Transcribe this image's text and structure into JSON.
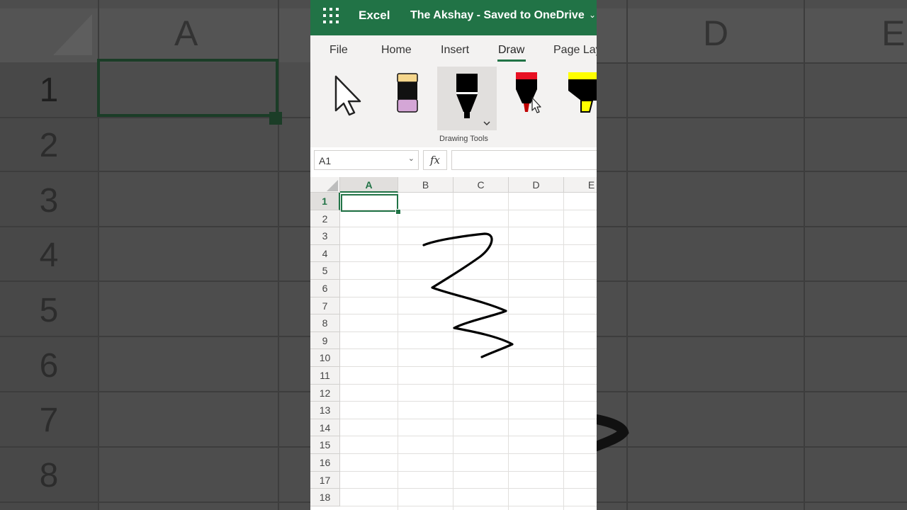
{
  "app": {
    "name": "Excel",
    "document_title": "The Akshay  -  Saved to OneDrive"
  },
  "tabs": [
    {
      "label": "File",
      "active": false
    },
    {
      "label": "Home",
      "active": false
    },
    {
      "label": "Insert",
      "active": false
    },
    {
      "label": "Draw",
      "active": true
    },
    {
      "label": "Page Layout",
      "active": false
    }
  ],
  "ribbon": {
    "group_label": "Drawing Tools",
    "tools": [
      {
        "name": "select-tool",
        "icon": "cursor-arrow"
      },
      {
        "name": "eraser-tool",
        "icon": "eraser"
      },
      {
        "name": "black-pen",
        "icon": "pen",
        "color": "#000000",
        "selected": true
      },
      {
        "name": "red-pen",
        "icon": "pen",
        "color": "#e81123"
      },
      {
        "name": "yellow-highlighter",
        "icon": "highlighter",
        "color": "#ffff00"
      }
    ]
  },
  "formula_bar": {
    "name_box": "A1",
    "fx_label": "fx",
    "formula": ""
  },
  "sheet": {
    "columns": [
      "A",
      "B",
      "C",
      "D",
      "E"
    ],
    "rows": [
      "1",
      "2",
      "3",
      "4",
      "5",
      "6",
      "7",
      "8",
      "9",
      "10",
      "11",
      "12",
      "13",
      "14",
      "15",
      "16",
      "17",
      "18"
    ],
    "active_cell": "A1"
  },
  "background_zoom": {
    "columns": [
      "A",
      "D",
      "E"
    ],
    "rows": [
      "1",
      "2",
      "3",
      "4",
      "5",
      "6",
      "7",
      "8"
    ]
  }
}
